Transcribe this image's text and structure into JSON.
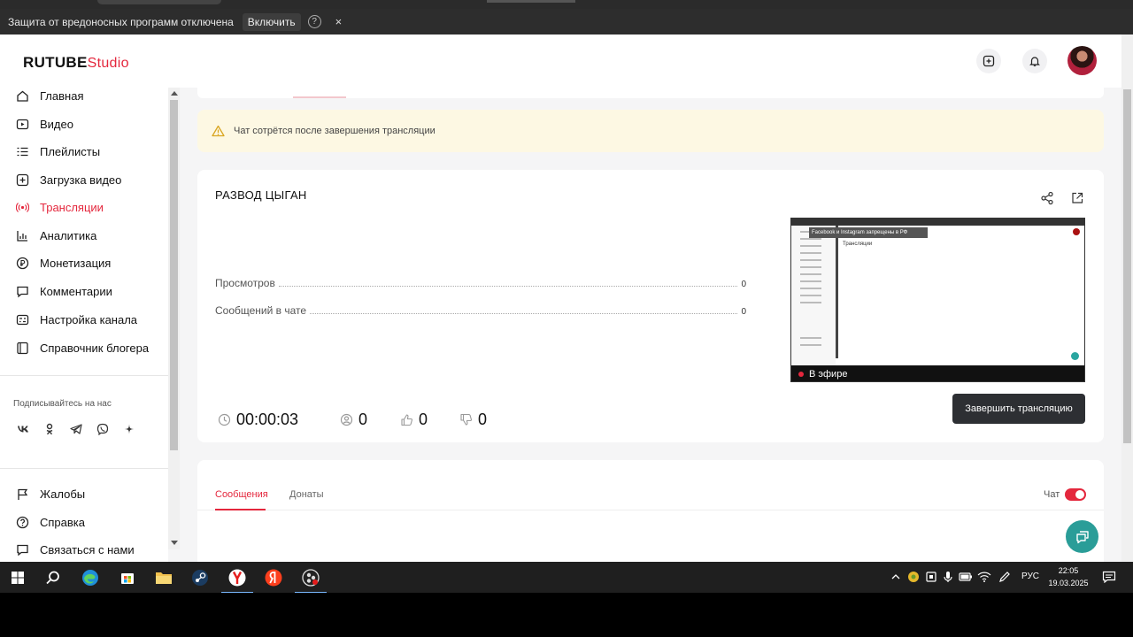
{
  "browser": {
    "security_warning": "Защита от вредоносных программ отключена",
    "enable_label": "Включить",
    "help_label": "?",
    "close_label": "×"
  },
  "header": {
    "logo_main": "RUTUBE",
    "logo_studio": "Studio"
  },
  "sidebar": {
    "items": [
      {
        "label": "Главная",
        "icon": "home-icon"
      },
      {
        "label": "Видео",
        "icon": "video-icon"
      },
      {
        "label": "Плейлисты",
        "icon": "playlist-icon"
      },
      {
        "label": "Загрузка видео",
        "icon": "upload-icon"
      },
      {
        "label": "Трансляции",
        "icon": "broadcast-icon",
        "active": true
      },
      {
        "label": "Аналитика",
        "icon": "analytics-icon"
      },
      {
        "label": "Монетизация",
        "icon": "ruble-icon"
      },
      {
        "label": "Комментарии",
        "icon": "comment-icon"
      },
      {
        "label": "Настройка канала",
        "icon": "settings-icon"
      },
      {
        "label": "Справочник блогера",
        "icon": "book-icon"
      }
    ],
    "follow_label": "Подписывайтесь на нас",
    "socials": [
      "vk-icon",
      "ok-icon",
      "telegram-icon",
      "viber-icon",
      "zen-icon"
    ],
    "bottom_items": [
      {
        "label": "Жалобы",
        "icon": "flag-icon"
      },
      {
        "label": "Справка",
        "icon": "help-icon"
      },
      {
        "label": "Связаться с нами",
        "icon": "contact-icon"
      }
    ]
  },
  "notice": {
    "text": "Чат сотрётся после завершения трансляции"
  },
  "stream": {
    "title": "РАЗВОД ЦЫГАН",
    "stats": [
      {
        "label": "Просмотров",
        "value": "0"
      },
      {
        "label": "Сообщений в чате",
        "value": "0"
      }
    ],
    "duration": "00:00:03",
    "viewers": "0",
    "likes": "0",
    "dislikes": "0",
    "end_button": "Завершить трансляцию",
    "preview": {
      "live_label": "В эфире",
      "banner": "Facebook и Instagram запрещены в РФ",
      "inner_title": "Трансляции"
    }
  },
  "chat": {
    "tabs": [
      "Сообщения",
      "Донаты"
    ],
    "toggle_label": "Чат",
    "toggle_on": true
  },
  "taskbar": {
    "language": "РУС",
    "time": "22:05",
    "date": "19.03.2025"
  },
  "colors": {
    "accent": "#e4273d",
    "notice_bg": "#fdf8e3",
    "fab": "#2a9d98",
    "end_button": "#2d2f33"
  }
}
